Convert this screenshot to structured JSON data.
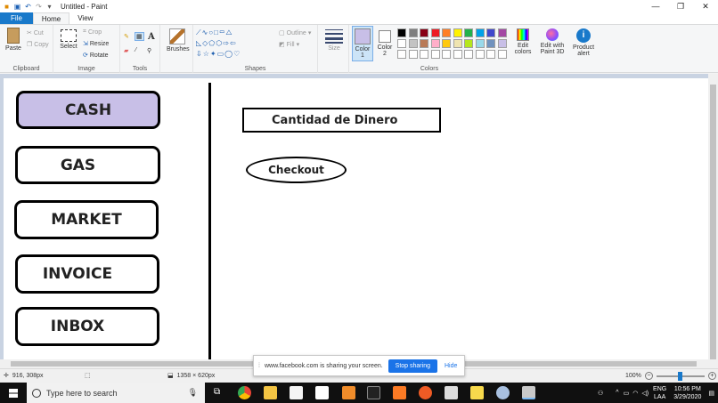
{
  "window": {
    "title": "Untitled - Paint",
    "controls": [
      "—",
      "❐",
      "✕"
    ]
  },
  "tabs": [
    {
      "label": "File"
    },
    {
      "label": "Home"
    },
    {
      "label": "View"
    }
  ],
  "ribbon": {
    "clipboard": {
      "paste": "Paste",
      "cut": "Cut",
      "copy": "Copy",
      "label": "Clipboard"
    },
    "image": {
      "select": "Select",
      "crop": "Crop",
      "resize": "Resize",
      "rotate": "Rotate",
      "label": "Image"
    },
    "tools": {
      "label": "Tools"
    },
    "brushes": {
      "label": "Brushes"
    },
    "shapes": {
      "outline": "Outline",
      "fill": "Fill",
      "label": "Shapes"
    },
    "size": {
      "label": "Size"
    },
    "colors": {
      "color1_line1": "Color",
      "color1_line2": "1",
      "color2_line1": "Color",
      "color2_line2": "2",
      "edit_line1": "Edit",
      "edit_line2": "colors",
      "paint3d_line1": "Edit with",
      "paint3d_line2": "Paint 3D",
      "alert_line1": "Product",
      "alert_line2": "alert",
      "label": "Colors",
      "color1_value": "#c8bfe7",
      "color2_value": "#ffffff",
      "palette_row1": [
        "#000000",
        "#7f7f7f",
        "#880015",
        "#ed1c24",
        "#ff7f27",
        "#fff200",
        "#22b14c",
        "#00a2e8",
        "#3f48cc",
        "#a349a4"
      ],
      "palette_row2": [
        "#ffffff",
        "#c3c3c3",
        "#b97a57",
        "#ffaec9",
        "#ffc90e",
        "#efe4b0",
        "#b5e61d",
        "#99d9ea",
        "#7092be",
        "#c8bfe7"
      ]
    }
  },
  "canvas": {
    "left_buttons": [
      {
        "label": "CASH",
        "fill": "#c8bfe7"
      },
      {
        "label": "GAS",
        "fill": "#ffffff"
      },
      {
        "label": "MARKET",
        "fill": "#ffffff"
      },
      {
        "label": "INVOICE",
        "fill": "#ffffff"
      },
      {
        "label": "INBOX",
        "fill": "#ffffff"
      }
    ],
    "amount_box": "Cantidad de Dinero",
    "checkout": "Checkout"
  },
  "status": {
    "cursor": "916, 308px",
    "canvas_size": "1358 × 620px",
    "zoom": "100%"
  },
  "share": {
    "message": "www.facebook.com is sharing your screen.",
    "stop": "Stop sharing",
    "hide": "Hide"
  },
  "taskbar": {
    "search_placeholder": "Type here to search",
    "lang": "ENG",
    "lang2": "LAA",
    "time": "10:56 PM",
    "date": "3/29/2020"
  }
}
